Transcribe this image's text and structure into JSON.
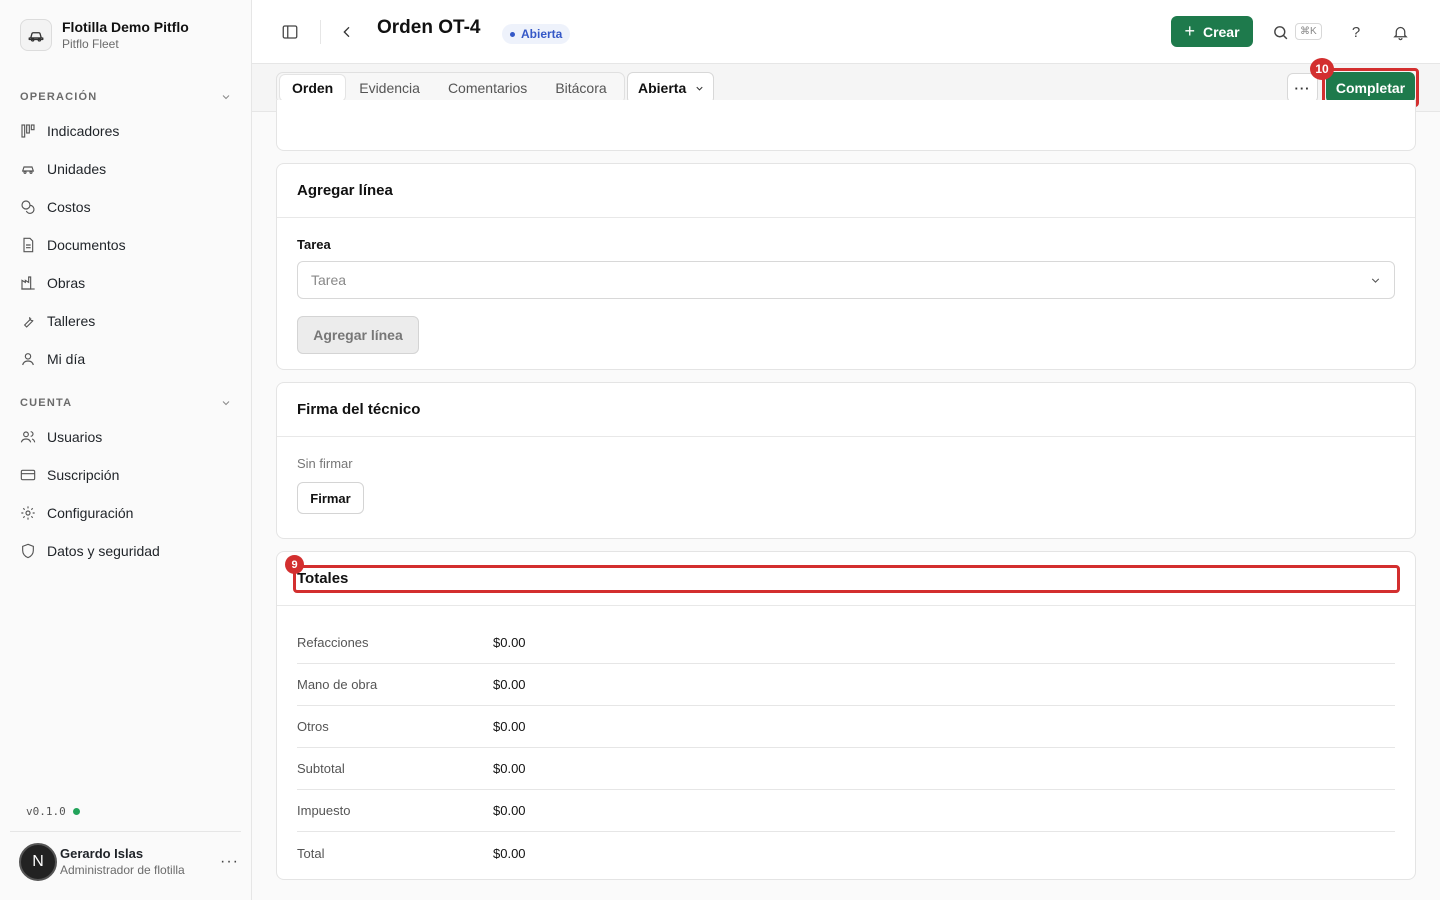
{
  "sidebar": {
    "brand": {
      "name": "Flotilla Demo Pitflo",
      "subtitle": "Pitflo Fleet"
    },
    "sections": [
      {
        "title": "OPERACIÓN",
        "items": [
          {
            "label": "Indicadores",
            "icon": "kanban-icon"
          },
          {
            "label": "Unidades",
            "icon": "car-icon"
          },
          {
            "label": "Costos",
            "icon": "coins-icon"
          },
          {
            "label": "Documentos",
            "icon": "document-icon"
          },
          {
            "label": "Obras",
            "icon": "factory-icon"
          },
          {
            "label": "Talleres",
            "icon": "wrench-icon"
          },
          {
            "label": "Mi día",
            "icon": "user-icon"
          }
        ]
      },
      {
        "title": "CUENTA",
        "items": [
          {
            "label": "Usuarios",
            "icon": "users-icon"
          },
          {
            "label": "Suscripción",
            "icon": "credit-card-icon"
          },
          {
            "label": "Configuración",
            "icon": "gear-icon"
          },
          {
            "label": "Datos y seguridad",
            "icon": "shield-icon"
          }
        ]
      }
    ],
    "version": "v0.1.0",
    "user": {
      "initial": "N",
      "name": "Gerardo Islas",
      "role": "Administrador de flotilla"
    }
  },
  "header": {
    "title": "Orden OT-4",
    "status_badge": "Abierta",
    "create_label": "Crear",
    "search_shortcut": "⌘K",
    "help_label": "?"
  },
  "tabs": {
    "items": [
      "Orden",
      "Evidencia",
      "Comentarios",
      "Bitácora"
    ],
    "active": "Orden",
    "status_select": "Abierta",
    "more_label": "···",
    "complete_label": "Completar"
  },
  "annotations": {
    "complete": "10",
    "totals": "9"
  },
  "add_line": {
    "title": "Agregar línea",
    "field_label": "Tarea",
    "placeholder": "Tarea",
    "button": "Agregar línea"
  },
  "signature": {
    "title": "Firma del técnico",
    "status": "Sin firmar",
    "button": "Firmar"
  },
  "totals": {
    "title": "Totales",
    "rows": [
      {
        "label": "Refacciones",
        "value": "$0.00"
      },
      {
        "label": "Mano de obra",
        "value": "$0.00"
      },
      {
        "label": "Otros",
        "value": "$0.00"
      },
      {
        "label": "Subtotal",
        "value": "$0.00"
      },
      {
        "label": "Impuesto",
        "value": "$0.00"
      },
      {
        "label": "Total",
        "value": "$0.00"
      }
    ]
  },
  "colors": {
    "primary": "#1e7a4c",
    "badge_blue": "#3558c7",
    "highlight_red": "#d32f2f"
  }
}
